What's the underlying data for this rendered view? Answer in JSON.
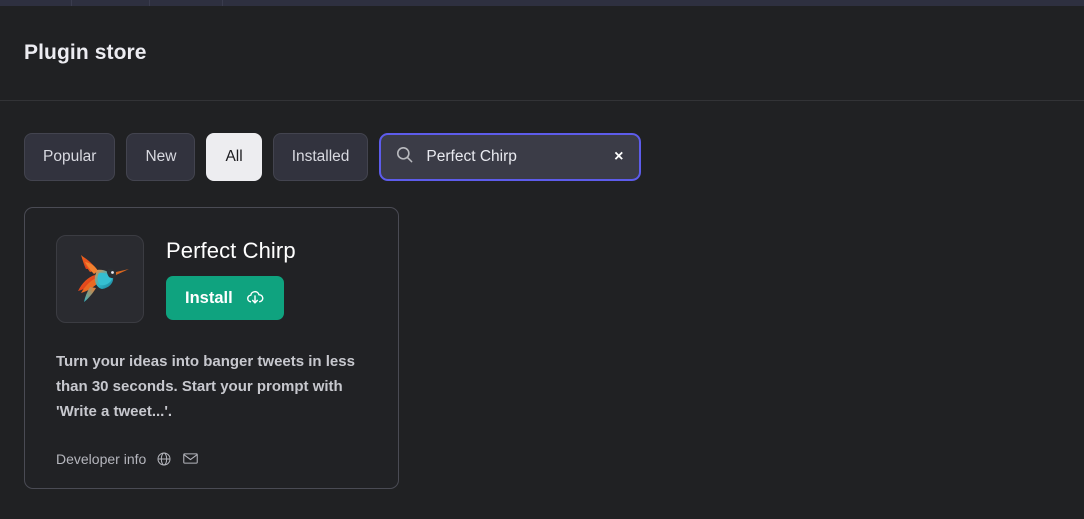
{
  "window": {
    "tabstrip_present": true
  },
  "header": {
    "title": "Plugin store"
  },
  "filters": {
    "items": [
      {
        "label": "Popular",
        "active": false,
        "name": "filter-popular"
      },
      {
        "label": "New",
        "active": false,
        "name": "filter-new"
      },
      {
        "label": "All",
        "active": true,
        "name": "filter-all"
      },
      {
        "label": "Installed",
        "active": false,
        "name": "filter-installed"
      }
    ]
  },
  "search": {
    "icon": "search-icon",
    "value": "Perfect Chirp",
    "placeholder": "Search plugins",
    "clear_label": "×",
    "focus_border_color": "#5d5ceb"
  },
  "plugins": [
    {
      "name": "Perfect Chirp",
      "logo_alt": "hummingbird-logo",
      "install_label": "Install",
      "install_icon": "cloud-download-icon",
      "install_color": "#0fa37f",
      "description": "Turn your ideas into banger tweets in less than 30 seconds. Start your prompt with 'Write a tweet...'.",
      "developer_info_label": "Developer info",
      "developer_links": [
        {
          "icon": "globe-icon"
        },
        {
          "icon": "mail-icon"
        }
      ]
    }
  ],
  "theme": {
    "background": "#202123",
    "header_background": "#202123",
    "card_background": "#212225",
    "accent_green": "#0fa37f",
    "accent_indigo": "#5d5ceb",
    "active_chip": "#ededf0"
  }
}
